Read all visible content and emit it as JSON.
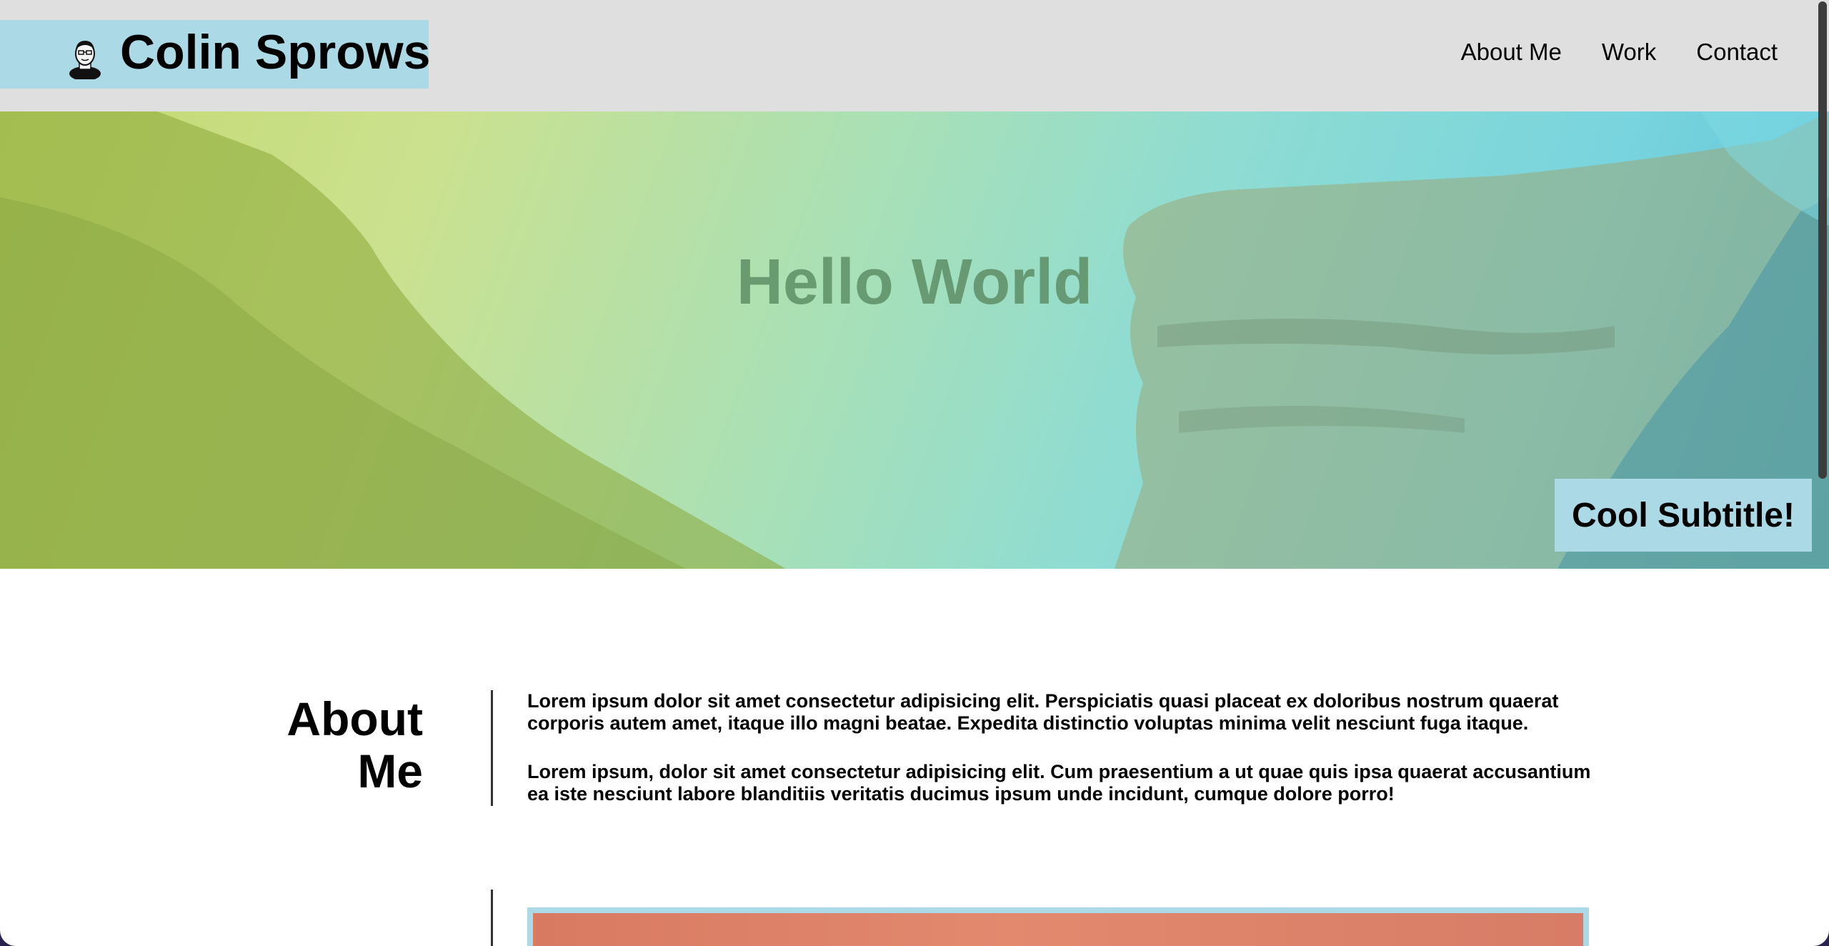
{
  "header": {
    "brand_name": "Colin Sprows",
    "nav": [
      {
        "label": "About Me"
      },
      {
        "label": "Work"
      },
      {
        "label": "Contact"
      }
    ]
  },
  "hero": {
    "title": "Hello World",
    "subtitle": "Cool Subtitle!"
  },
  "about": {
    "heading_line1": "About",
    "heading_line2": "Me",
    "paragraphs": [
      "Lorem ipsum dolor sit amet consectetur adipisicing elit. Perspiciatis quasi placeat ex doloribus nostrum quaerat corporis autem amet, itaque illo magni beatae. Expedita distinctio voluptas minima velit nesciunt fuga itaque.",
      "Lorem ipsum, dolor sit amet consectetur adipisicing elit. Cum praesentium a ut quae quis ipsa quaerat accusantium ea iste nesciunt labore blanditiis veritatis ducimus ipsum unde incidunt, cumque dolore porro!"
    ]
  },
  "colors": {
    "brand_bg": "#acd9e6",
    "header_bg": "#dfdfdf",
    "hero_title": "#5e8f66"
  },
  "icons": {
    "avatar": "avatar-icon"
  }
}
